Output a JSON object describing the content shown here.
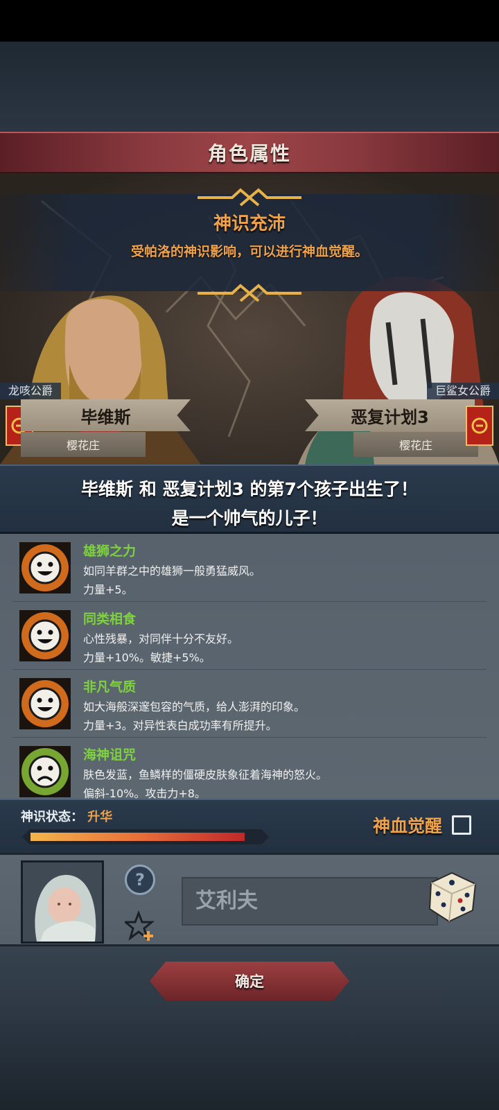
{
  "header": {
    "title": "角色属性"
  },
  "banner": {
    "title": "神识充沛",
    "subtitle": "受帕洛的神识影响，可以进行神血觉醒。"
  },
  "parents": {
    "left": {
      "rank": "龙咳公爵",
      "name": "毕维斯",
      "estate": "樱花庄"
    },
    "right": {
      "rank": "巨鲨女公爵",
      "name": "恶复计划3",
      "estate": "樱花庄"
    }
  },
  "birth": {
    "line1": "毕维斯 和 恶复计划3 的第7个孩子出生了！",
    "line2": "是一个帅气的儿子！"
  },
  "traits": [
    {
      "name": "雄狮之力",
      "desc": "如同羊群之中的雄狮一般勇猛威风。",
      "effect": "力量+5。",
      "icon": "smile-face-icon",
      "positive": true
    },
    {
      "name": "同类相食",
      "desc": "心性残暴，对同伴十分不友好。",
      "effect": "力量+10%。敏捷+5%。",
      "icon": "smile-face-icon",
      "positive": true
    },
    {
      "name": "非凡气质",
      "desc": "如大海般深邃包容的气质，给人澎湃的印象。",
      "effect": "力量+3。对异性表白成功率有所提升。",
      "icon": "smile-face-icon",
      "positive": true
    },
    {
      "name": "海神诅咒",
      "desc": "肤色发蓝，鱼鳞样的僵硬皮肤象征着海神的怒火。",
      "effect": "偏斜-10%。攻击力+8。",
      "icon": "sad-face-icon",
      "positive": false
    }
  ],
  "status": {
    "label": "神识状态：",
    "value": "升华",
    "progress": 0.93,
    "awaken_label": "神血觉醒",
    "awaken_checked": false
  },
  "child": {
    "help_symbol": "?",
    "name_value": "艾利夫"
  },
  "footer": {
    "confirm_label": "确定"
  },
  "colors": {
    "accent_orange": "#f0a24a",
    "trait_green": "#7ed23e",
    "title_red": "#8a3a3f"
  }
}
